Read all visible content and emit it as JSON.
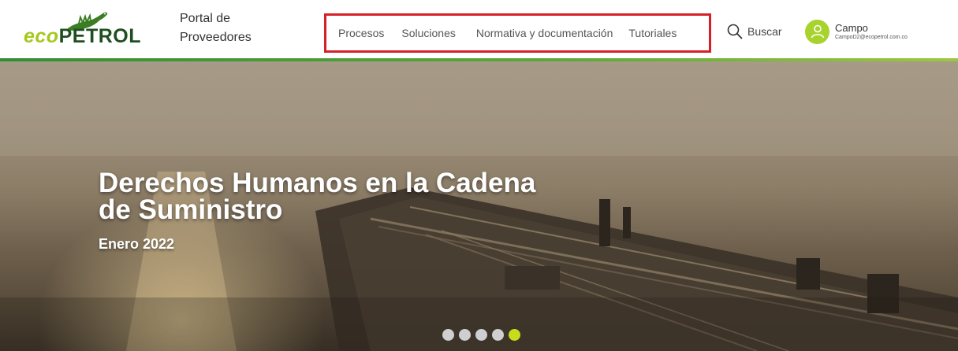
{
  "header": {
    "logo": {
      "part1": "eco",
      "part2": "PETROL",
      "brand_color": "#a6c81e",
      "dark_color": "#1f4e1f"
    },
    "portal_title": {
      "line1": "Portal de",
      "line2": "Proveedores"
    },
    "nav": [
      {
        "label": "Procesos"
      },
      {
        "label": "Soluciones"
      },
      {
        "label": "Normativa y documentación"
      },
      {
        "label": "Tutoriales"
      }
    ],
    "highlight_color": "#d62027",
    "search": {
      "icon": "search-icon",
      "label": "Buscar"
    },
    "user": {
      "icon": "user-icon",
      "name": "Campo",
      "email": "CampoD2@ecopetrol.com.co",
      "avatar_color": "#a8d22c"
    }
  },
  "hero": {
    "title": "Derechos Humanos en la Cadena de Suministro",
    "subtitle": "Enero 2022",
    "slides": {
      "count": 5,
      "active_index": 4,
      "active_color": "#c8dc1e"
    }
  }
}
